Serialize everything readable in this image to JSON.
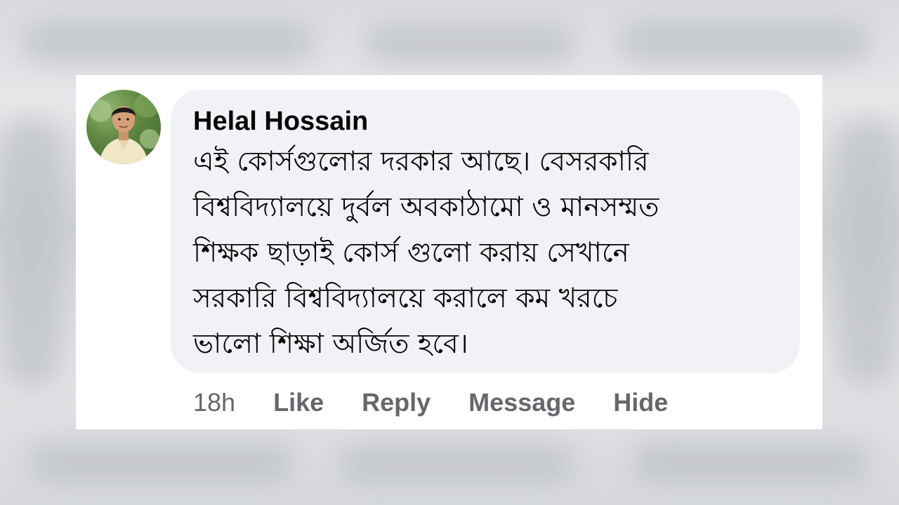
{
  "comment": {
    "author": "Helal Hossain",
    "text_lines": [
      "এই কোর্সগুলোর দরকার আছে।  বেসরকারি",
      "বিশ্ববিদ্যালয়ে দুর্বল অবকাঠামো ও মানসম্মত",
      "শিক্ষক ছাড়াই কোর্স গুলো করায় সেখানে",
      "সরকারি বিশ্ববিদ্যালয়ে করালে কম খরচে",
      "ভালো শিক্ষা অর্জিত হবে।"
    ],
    "time": "18h",
    "actions": {
      "like": "Like",
      "reply": "Reply",
      "message": "Message",
      "hide": "Hide"
    }
  },
  "colors": {
    "bubble": "#f0f2f5",
    "text": "#050505",
    "meta": "#65676b"
  }
}
